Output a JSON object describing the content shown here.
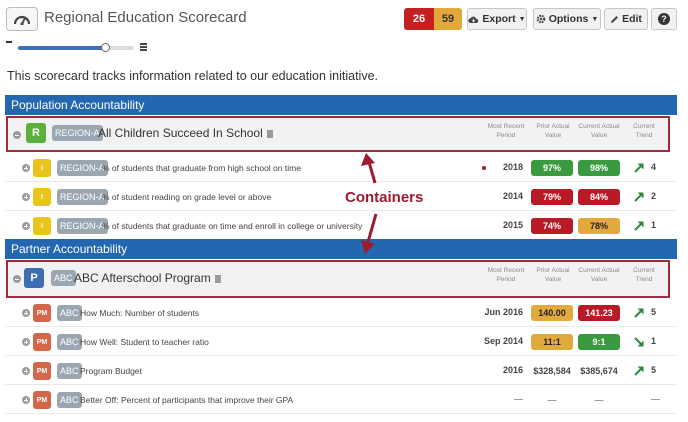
{
  "header": {
    "title": "Regional Education Scorecard",
    "icon": "dashboard-icon",
    "badges": {
      "red": "26",
      "yellow": "59"
    },
    "buttons": {
      "export": "Export",
      "options": "Options",
      "edit": "Edit",
      "help": "?"
    }
  },
  "description": "This scorecard tracks information related to our education initiative.",
  "columns": {
    "period": "Most Recent Period",
    "prior": "Prior Actual Value",
    "current": "Current Actual Value",
    "trend": "Current Trend"
  },
  "annotation": {
    "label": "Containers"
  },
  "sections": [
    {
      "title": "Population Accountability",
      "container": {
        "type_letter": "R",
        "tag": "REGION-A",
        "name": "All Children Succeed In School"
      },
      "rows": [
        {
          "type": "I",
          "tag": "REGION-A",
          "name": "% of students that graduate from high school on time",
          "period": "2018",
          "prior": "97%",
          "current": "98%",
          "trend": "4"
        },
        {
          "type": "I",
          "tag": "REGION-A",
          "name": "% of student reading on grade level or above",
          "period": "2014",
          "prior": "79%",
          "current": "84%",
          "trend": "2"
        },
        {
          "type": "I",
          "tag": "REGION-A",
          "name": "% of students that graduate on time and enroll in college or university",
          "period": "2015",
          "prior": "74%",
          "current": "78%",
          "trend": "1"
        }
      ]
    },
    {
      "title": "Partner Accountability",
      "container": {
        "type_letter": "P",
        "tag": "ABC",
        "name": "ABC Afterschool Program"
      },
      "rows": [
        {
          "type": "PM",
          "tag": "ABC",
          "name": "How Much: Number of students",
          "period": "Jun 2016",
          "prior": "140.00",
          "current": "141.23",
          "trend": "5"
        },
        {
          "type": "PM",
          "tag": "ABC",
          "name": "How Well: Student to teacher ratio",
          "period": "Sep 2014",
          "prior": "11:1",
          "current": "9:1",
          "trend": "1"
        },
        {
          "type": "PM",
          "tag": "ABC",
          "name": "Program Budget",
          "period": "2016",
          "prior": "$328,584",
          "current": "$385,674",
          "trend": "5"
        },
        {
          "type": "PM",
          "tag": "ABC",
          "name": "Better Off: Percent of participants that improve their GPA",
          "period": "—",
          "prior": "—",
          "current": "—",
          "trend": "—"
        }
      ]
    }
  ],
  "colors": {
    "blue": "#2367b0",
    "red": "#b81b27",
    "green": "#3a9a3f",
    "yellow": "#e2aa3c",
    "annotation": "#9b1c2e"
  },
  "slider": {
    "zoom_fraction": 0.75
  }
}
